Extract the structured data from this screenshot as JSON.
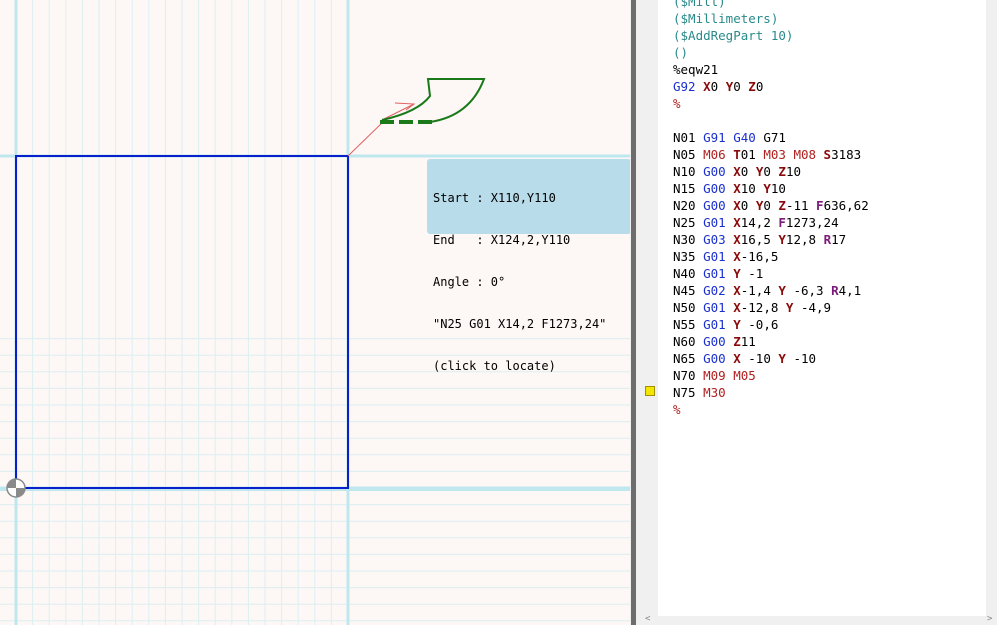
{
  "tooltip": {
    "lines": [
      "Start : X110,Y110",
      "End   : X124,2,Y110",
      "Angle : 0°",
      "\"N25 G01 X14,2 F1273,24\"",
      "(click to locate)"
    ]
  },
  "code": {
    "lines": [
      [
        {
          "t": "($Mill)",
          "c": "cm"
        }
      ],
      [
        {
          "t": "($Millimeters)",
          "c": "cm"
        }
      ],
      [
        {
          "t": "($AddRegPart 10)",
          "c": "cm"
        }
      ],
      [
        {
          "t": "()",
          "c": "cm"
        }
      ],
      [
        {
          "t": "%eqw21",
          "c": ""
        }
      ],
      [
        {
          "t": "G92",
          "c": "g"
        },
        {
          "t": " ",
          "c": ""
        },
        {
          "t": "X",
          "c": "a"
        },
        {
          "t": "0 ",
          "c": ""
        },
        {
          "t": "Y",
          "c": "a"
        },
        {
          "t": "0 ",
          "c": ""
        },
        {
          "t": "Z",
          "c": "a"
        },
        {
          "t": "0",
          "c": ""
        }
      ],
      [
        {
          "t": "%",
          "c": "pct"
        }
      ],
      [
        {
          "t": "",
          "c": ""
        }
      ],
      [
        {
          "t": "N01 ",
          "c": ""
        },
        {
          "t": "G91",
          "c": "g"
        },
        {
          "t": " ",
          "c": ""
        },
        {
          "t": "G40",
          "c": "g"
        },
        {
          "t": " G71",
          "c": ""
        }
      ],
      [
        {
          "t": "N05 ",
          "c": ""
        },
        {
          "t": "M06",
          "c": "m"
        },
        {
          "t": " ",
          "c": ""
        },
        {
          "t": "T",
          "c": "a"
        },
        {
          "t": "01 ",
          "c": ""
        },
        {
          "t": "M03",
          "c": "m"
        },
        {
          "t": " ",
          "c": ""
        },
        {
          "t": "M08",
          "c": "m"
        },
        {
          "t": " ",
          "c": ""
        },
        {
          "t": "S",
          "c": "a"
        },
        {
          "t": "3183",
          "c": ""
        }
      ],
      [
        {
          "t": "N10 ",
          "c": ""
        },
        {
          "t": "G00",
          "c": "g"
        },
        {
          "t": " ",
          "c": ""
        },
        {
          "t": "X",
          "c": "a"
        },
        {
          "t": "0 ",
          "c": ""
        },
        {
          "t": "Y",
          "c": "a"
        },
        {
          "t": "0 ",
          "c": ""
        },
        {
          "t": "Z",
          "c": "a"
        },
        {
          "t": "10",
          "c": ""
        }
      ],
      [
        {
          "t": "N15 ",
          "c": ""
        },
        {
          "t": "G00",
          "c": "g"
        },
        {
          "t": " ",
          "c": ""
        },
        {
          "t": "X",
          "c": "a"
        },
        {
          "t": "10 ",
          "c": ""
        },
        {
          "t": "Y",
          "c": "a"
        },
        {
          "t": "10",
          "c": ""
        }
      ],
      [
        {
          "t": "N20 ",
          "c": ""
        },
        {
          "t": "G00",
          "c": "g"
        },
        {
          "t": " ",
          "c": ""
        },
        {
          "t": "X",
          "c": "a"
        },
        {
          "t": "0 ",
          "c": ""
        },
        {
          "t": "Y",
          "c": "a"
        },
        {
          "t": "0 ",
          "c": ""
        },
        {
          "t": "Z",
          "c": "a"
        },
        {
          "t": "-11 ",
          "c": ""
        },
        {
          "t": "F",
          "c": "f"
        },
        {
          "t": "636,62",
          "c": ""
        }
      ],
      [
        {
          "t": "N25 ",
          "c": ""
        },
        {
          "t": "G01",
          "c": "g"
        },
        {
          "t": " ",
          "c": ""
        },
        {
          "t": "X",
          "c": "a"
        },
        {
          "t": "14,2 ",
          "c": ""
        },
        {
          "t": "F",
          "c": "f"
        },
        {
          "t": "1273,24",
          "c": ""
        }
      ],
      [
        {
          "t": "N30 ",
          "c": ""
        },
        {
          "t": "G03",
          "c": "g"
        },
        {
          "t": " ",
          "c": ""
        },
        {
          "t": "X",
          "c": "a"
        },
        {
          "t": "16,5 ",
          "c": ""
        },
        {
          "t": "Y",
          "c": "a"
        },
        {
          "t": "12,8 ",
          "c": ""
        },
        {
          "t": "R",
          "c": "f"
        },
        {
          "t": "17",
          "c": ""
        }
      ],
      [
        {
          "t": "N35 ",
          "c": ""
        },
        {
          "t": "G01",
          "c": "g"
        },
        {
          "t": " ",
          "c": ""
        },
        {
          "t": "X",
          "c": "a"
        },
        {
          "t": "-16,5",
          "c": ""
        }
      ],
      [
        {
          "t": "N40 ",
          "c": ""
        },
        {
          "t": "G01",
          "c": "g"
        },
        {
          "t": " ",
          "c": ""
        },
        {
          "t": "Y",
          "c": "a"
        },
        {
          "t": " -1",
          "c": ""
        }
      ],
      [
        {
          "t": "N45 ",
          "c": ""
        },
        {
          "t": "G02",
          "c": "g"
        },
        {
          "t": " ",
          "c": ""
        },
        {
          "t": "X",
          "c": "a"
        },
        {
          "t": "-1,4 ",
          "c": ""
        },
        {
          "t": "Y",
          "c": "a"
        },
        {
          "t": " -6,3 ",
          "c": ""
        },
        {
          "t": "R",
          "c": "f"
        },
        {
          "t": "4,1",
          "c": ""
        }
      ],
      [
        {
          "t": "N50 ",
          "c": ""
        },
        {
          "t": "G01",
          "c": "g"
        },
        {
          "t": " ",
          "c": ""
        },
        {
          "t": "X",
          "c": "a"
        },
        {
          "t": "-12,8 ",
          "c": ""
        },
        {
          "t": "Y",
          "c": "a"
        },
        {
          "t": " -4,9",
          "c": ""
        }
      ],
      [
        {
          "t": "N55 ",
          "c": ""
        },
        {
          "t": "G01",
          "c": "g"
        },
        {
          "t": " ",
          "c": ""
        },
        {
          "t": "Y",
          "c": "a"
        },
        {
          "t": " -0,6",
          "c": ""
        }
      ],
      [
        {
          "t": "N60 ",
          "c": ""
        },
        {
          "t": "G00",
          "c": "g"
        },
        {
          "t": " ",
          "c": ""
        },
        {
          "t": "Z",
          "c": "a"
        },
        {
          "t": "11",
          "c": ""
        }
      ],
      [
        {
          "t": "N65 ",
          "c": ""
        },
        {
          "t": "G00",
          "c": "g"
        },
        {
          "t": " ",
          "c": ""
        },
        {
          "t": "X",
          "c": "a"
        },
        {
          "t": " -10 ",
          "c": ""
        },
        {
          "t": "Y",
          "c": "a"
        },
        {
          "t": " -10",
          "c": ""
        }
      ],
      [
        {
          "t": "N70 ",
          "c": ""
        },
        {
          "t": "M09",
          "c": "m"
        },
        {
          "t": " ",
          "c": ""
        },
        {
          "t": "M05",
          "c": "m"
        }
      ],
      [
        {
          "t": "N75 ",
          "c": ""
        },
        {
          "t": "M30",
          "c": "m"
        }
      ],
      [
        {
          "t": "%",
          "c": "pct"
        }
      ]
    ]
  },
  "colors": {
    "grid_minor": "#dceff2",
    "grid_major": "#bfe8ee",
    "part_outline": "#0a1fcc",
    "toolpath": "#1a7a1a",
    "rapid_move": "#e06060",
    "tooltip_bg": "#b8dcea",
    "marker": "#f5e600"
  },
  "icons": {
    "origin": "origin-marker-icon",
    "current_line": "current-line-marker-icon",
    "scroll_left": "scroll-left-arrow-icon",
    "scroll_right": "scroll-right-arrow-icon"
  }
}
